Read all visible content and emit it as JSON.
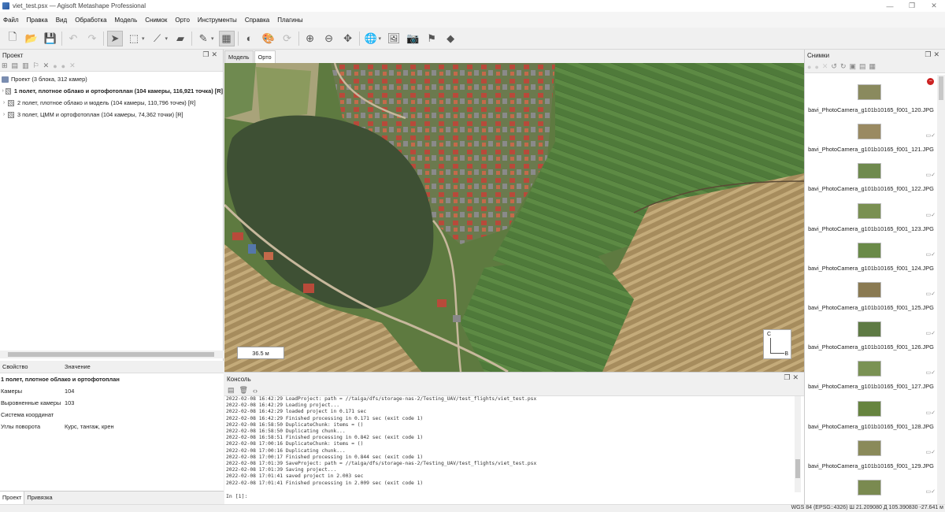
{
  "window": {
    "title": "viet_test.psx — Agisoft Metashape Professional",
    "controls": [
      "—",
      "❐",
      "✕"
    ]
  },
  "menu": [
    "Файл",
    "Правка",
    "Вид",
    "Обработка",
    "Модель",
    "Снимок",
    "Орто",
    "Инструменты",
    "Справка",
    "Плагины"
  ],
  "project_panel": {
    "title": "Проект",
    "root": "Проект (3 блока, 312 камер)",
    "chunks": [
      {
        "label": "1 полет, плотное облако и ортофотоплан (104 камеры, 116,921 точка) [R]",
        "bold": true
      },
      {
        "label": "2 полет, плотное облако и модель (104 камеры, 110,796 точек) [R]",
        "bold": false
      },
      {
        "label": "3 полет, ЦММ и ортофотоплан (104 камеры, 74,362 точки) [R]",
        "bold": false
      }
    ]
  },
  "properties": {
    "col_property": "Свойство",
    "col_value": "Значение",
    "chunk_name": "1 полет, плотное облако и ортофотоплан",
    "rows": [
      {
        "key": "Камеры",
        "value": "104"
      },
      {
        "key": "Выровненные камеры",
        "value": "103"
      },
      {
        "key": "Система координат",
        "value": ""
      },
      {
        "key": "Углы поворота",
        "value": "Курс, тангаж, крен"
      }
    ]
  },
  "left_tabs": [
    "Проект",
    "Привязка"
  ],
  "view_tabs": [
    "Модель",
    "Орто"
  ],
  "ortho": {
    "scale_label": "36.5 м",
    "compass_north": "С",
    "compass_east": "В"
  },
  "console": {
    "title": "Консоль",
    "lines": [
      "2022-02-08 16:42:29 LoadProject: path = //taiga/dfs/storage-nas-2/Testing_UAV/test_flights/viet_test.psx",
      "2022-02-08 16:42:29 Loading project...",
      "2022-02-08 16:42:29 loaded project in 0.171 sec",
      "2022-02-08 16:42:29 Finished processing in 0.171 sec (exit code 1)",
      "2022-02-08 16:58:50 DuplicateChunk: items = ()",
      "2022-02-08 16:58:50 Duplicating chunk...",
      "2022-02-08 16:58:51 Finished processing in 0.842 sec (exit code 1)",
      "2022-02-08 17:00:16 DuplicateChunk: items = ()",
      "2022-02-08 17:00:16 Duplicating chunk...",
      "2022-02-08 17:00:17 Finished processing in 0.844 sec (exit code 1)",
      "2022-02-08 17:01:39 SaveProject: path = //taiga/dfs/storage-nas-2/Testing_UAV/test_flights/viet_test.psx",
      "2022-02-08 17:01:39 Saving project...",
      "2022-02-08 17:01:41 saved project in 2.003 sec",
      "2022-02-08 17:01:41 Finished processing in 2.009 sec (exit code 1)"
    ],
    "prompt": "In [1]:"
  },
  "photos_panel": {
    "title": "Снимки",
    "photos": [
      {
        "name": "bavi_PhotoCamera_g101b10165_f001_120.JPG",
        "aligned": false
      },
      {
        "name": "bavi_PhotoCamera_g101b10165_f001_121.JPG",
        "aligned": true
      },
      {
        "name": "bavi_PhotoCamera_g101b10165_f001_122.JPG",
        "aligned": true
      },
      {
        "name": "bavi_PhotoCamera_g101b10165_f001_123.JPG",
        "aligned": true
      },
      {
        "name": "bavi_PhotoCamera_g101b10165_f001_124.JPG",
        "aligned": true
      },
      {
        "name": "bavi_PhotoCamera_g101b10165_f001_125.JPG",
        "aligned": true
      },
      {
        "name": "bavi_PhotoCamera_g101b10165_f001_126.JPG",
        "aligned": true
      },
      {
        "name": "bavi_PhotoCamera_g101b10165_f001_127.JPG",
        "aligned": true
      },
      {
        "name": "bavi_PhotoCamera_g101b10165_f001_128.JPG",
        "aligned": true
      },
      {
        "name": "bavi_PhotoCamera_g101b10165_f001_129.JPG",
        "aligned": true
      },
      {
        "name": "",
        "aligned": true
      }
    ]
  },
  "status": {
    "coordinates": "WGS 84 (EPSG::4326)  Ш 21.209080  Д 105.390830  -27.641 м"
  }
}
